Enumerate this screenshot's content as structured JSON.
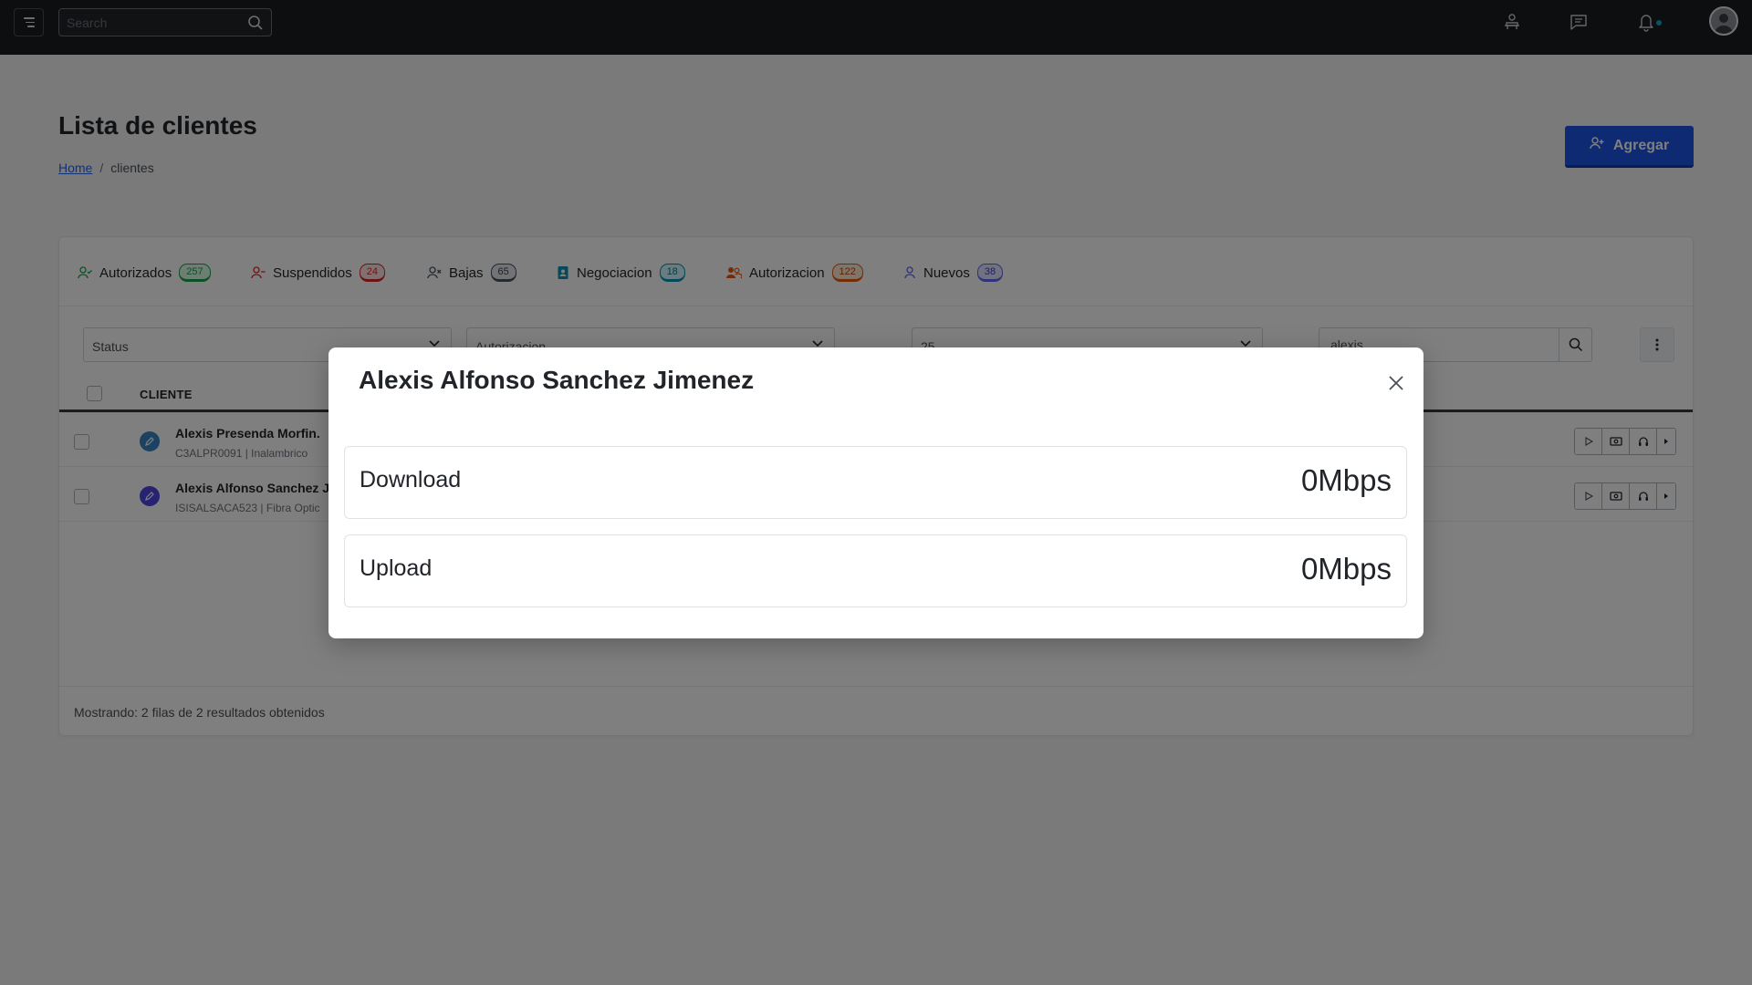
{
  "topbar": {
    "search_placeholder": "Search",
    "icons": [
      "menu-icon",
      "search-icon",
      "users-table-icon",
      "chat-icon",
      "bell-icon",
      "avatar"
    ],
    "notification_dot_color": "#16a3c9"
  },
  "header": {
    "title": "Lista de clientes",
    "breadcrumb_home": "Home",
    "breadcrumb_sep": "/",
    "breadcrumb_current": "clientes",
    "add_button": "Agregar",
    "accent": "#1a55e6"
  },
  "tabs": [
    {
      "label": "Autorizados",
      "count": "257",
      "color": "#16a34a"
    },
    {
      "label": "Suspendidos",
      "count": "24",
      "color": "#dc2626"
    },
    {
      "label": "Bajas",
      "count": "65",
      "color": "#4b5563"
    },
    {
      "label": "Negociacion",
      "count": "18",
      "color": "#0891b2"
    },
    {
      "label": "Autorizacion",
      "count": "122",
      "color": "#ea580c"
    },
    {
      "label": "Nuevos",
      "count": "38",
      "color": "#6366f1"
    }
  ],
  "filters": {
    "status": "Status",
    "autorizacion": "Autorizacion",
    "page_size": "25",
    "search_value": "alexis"
  },
  "table": {
    "header": "CLIENTE",
    "rows": [
      {
        "name": "Alexis Presenda Morfin.",
        "sub": "C3ALPR0091 | Inalambrico",
        "icon_color": "#3b82c4"
      },
      {
        "name": "Alexis Alfonso Sanchez J",
        "sub": "ISISALSACA523 | Fibra Optic",
        "icon_color": "#4f46e5"
      }
    ]
  },
  "footer": {
    "text": "Mostrando: 2 filas de 2 resultados obtenidos"
  },
  "modal": {
    "title": "Alexis Alfonso Sanchez Jimenez",
    "stats": [
      {
        "label": "Download",
        "value": "0Mbps"
      },
      {
        "label": "Upload",
        "value": "0Mbps"
      }
    ]
  }
}
